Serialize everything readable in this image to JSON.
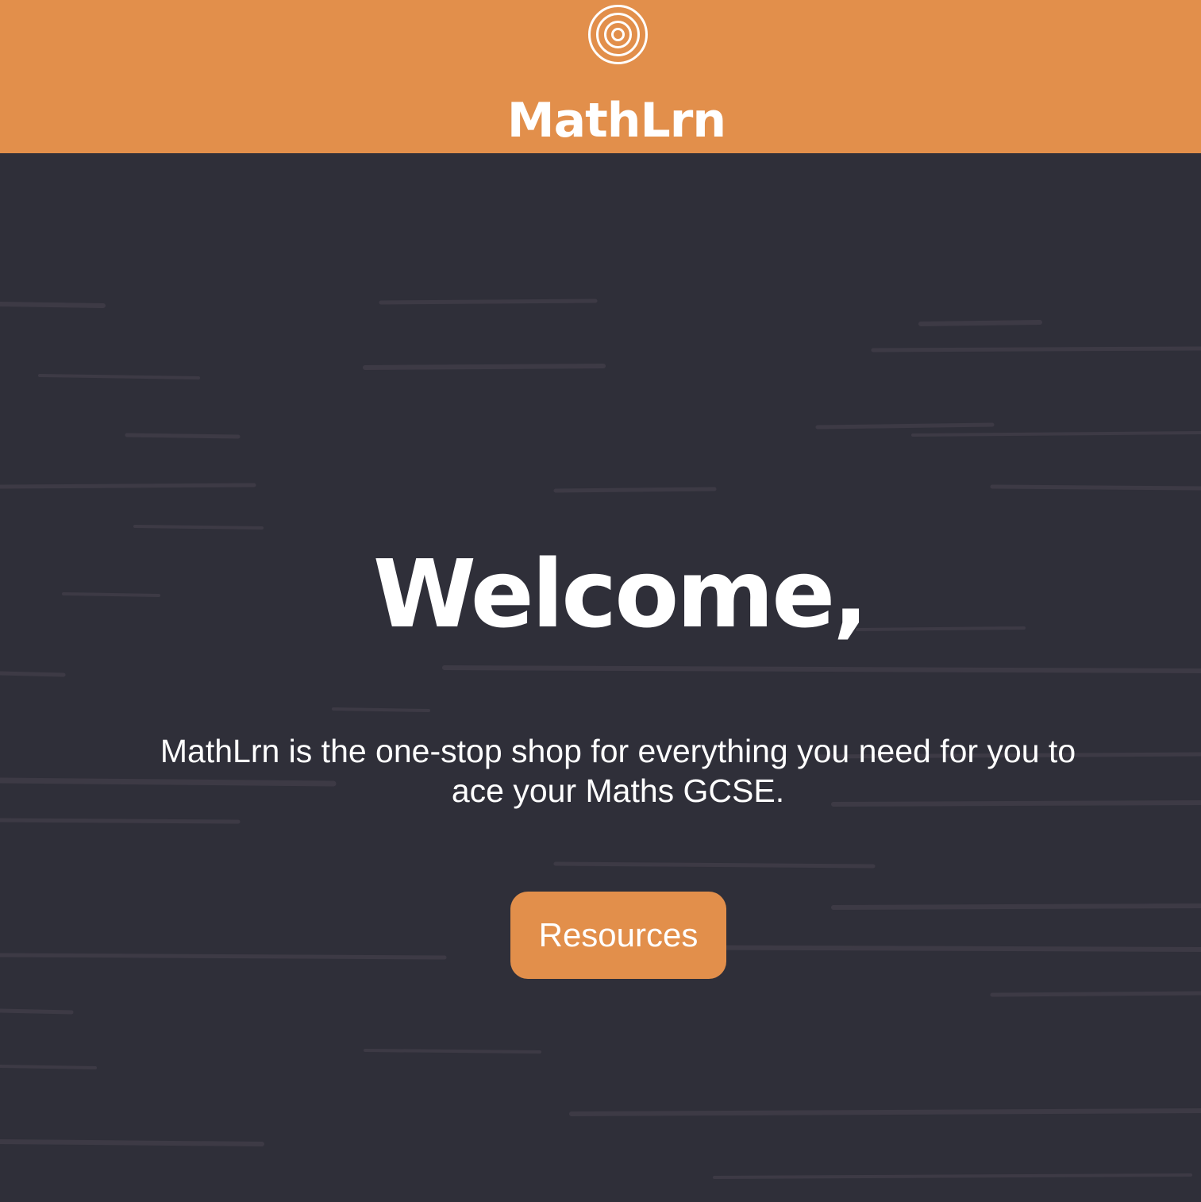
{
  "header": {
    "logo_icon": "concentric-circles-icon",
    "brand_name": "MathLrn",
    "background_color": "#e28f4b"
  },
  "hero": {
    "heading": "Welcome,",
    "tagline": "MathLrn is the one-stop shop for everything you need for you to ace your Maths GCSE.",
    "resources_button_label": "Resources",
    "background_color": "#2f2f39",
    "button_color": "#e28f4b"
  }
}
